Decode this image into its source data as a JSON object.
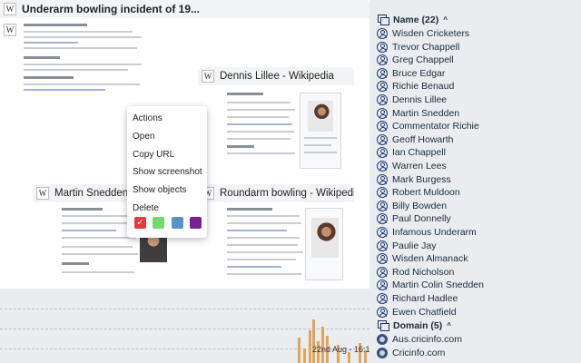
{
  "cards": {
    "underarm": {
      "title": "Underarm bowling incident of 19..."
    },
    "lillee": {
      "title": "Dennis Lillee - Wikipedia"
    },
    "snedden": {
      "title": "Martin Snedden - W"
    },
    "roundarm": {
      "title": "Roundarm bowling - Wikipedia"
    },
    "wiki_letter": "W"
  },
  "context_menu": {
    "items": [
      "Actions",
      "Open",
      "Copy URL",
      "Show screenshot",
      "Show objects",
      "Delete"
    ],
    "colors": [
      {
        "name": "red",
        "hex": "#e23b3b",
        "selected": true
      },
      {
        "name": "green",
        "hex": "#6fd96a",
        "selected": false
      },
      {
        "name": "blue",
        "hex": "#5a93c8",
        "selected": false
      },
      {
        "name": "purple",
        "hex": "#7a1e9a",
        "selected": false
      }
    ],
    "check_glyph": "✓"
  },
  "timeline": {
    "label": "22nd Aug - 16:12"
  },
  "panel": {
    "name_header": "Name (22)",
    "names": [
      "Wisden Cricketers",
      "Trevor Chappell",
      "Greg Chappell",
      "Bruce Edgar",
      "Richie Benaud",
      "Dennis Lillee",
      "Martin Snedden",
      "Commentator Richie",
      "Geoff Howarth",
      "Ian Chappell",
      "Warren Lees",
      "Mark Burgess",
      "Robert Muldoon",
      "Billy Bowden",
      "Paul Donnelly",
      "Infamous Underarm",
      "Paulie Jay",
      "Wisden Almanack",
      "Rod Nicholson",
      "Martin Colin Snedden",
      "Richard Hadlee",
      "Ewen Chatfield"
    ],
    "domain_header": "Domain (5)",
    "domains": [
      "Aus.cricinfo.com",
      "Cricinfo.com"
    ],
    "collapse_glyph": "^"
  },
  "icons": {
    "name_group": "stack-icon",
    "person": "person-icon",
    "domain": "domain-icon",
    "chevron": "chevron-up-icon"
  }
}
